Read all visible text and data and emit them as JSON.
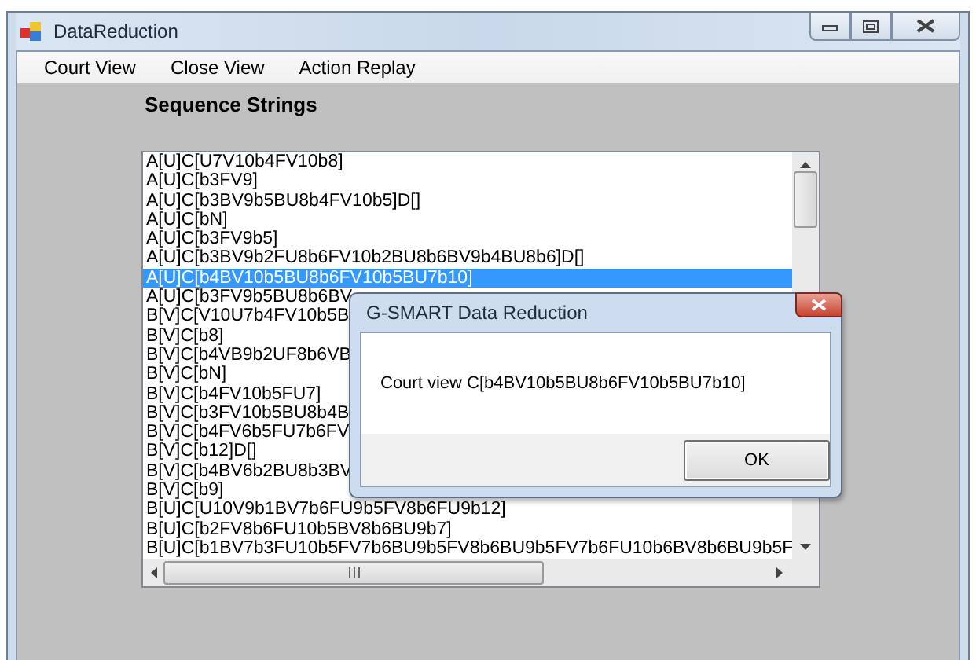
{
  "window": {
    "title": "DataReduction"
  },
  "menu": [
    {
      "label": "Court View"
    },
    {
      "label": "Close View"
    },
    {
      "label": "Action Replay"
    }
  ],
  "heading": "Sequence Strings",
  "list": {
    "items": [
      {
        "text": "A[U]C[U7V10b4FV10b8]",
        "selected": false
      },
      {
        "text": "A[U]C[b3FV9]",
        "selected": false
      },
      {
        "text": "A[U]C[b3BV9b5BU8b4FV10b5]D[]",
        "selected": false
      },
      {
        "text": "A[U]C[bN]",
        "selected": false
      },
      {
        "text": "A[U]C[b3FV9b5]",
        "selected": false
      },
      {
        "text": "A[U]C[b3BV9b2FU8b6FV10b2BU8b6BV9b4BU8b6]D[]",
        "selected": false
      },
      {
        "text": "A[U]C[b4BV10b5BU8b6FV10b5BU7b10]",
        "selected": true
      },
      {
        "text": "A[U]C[b3FV9b5BU8b6BV",
        "selected": false
      },
      {
        "text": "B[V]C[V10U7b4FV10b5B",
        "selected": false
      },
      {
        "text": "B[V]C[b8]",
        "selected": false
      },
      {
        "text": "B[V]C[b4VB9b2UF8b6VB",
        "selected": false
      },
      {
        "text": "B[V]C[bN]",
        "selected": false
      },
      {
        "text": "B[V]C[b4FV10b5FU7]",
        "selected": false
      },
      {
        "text": "B[V]C[b3FV10b5BU8b4B",
        "selected": false
      },
      {
        "text": "B[V]C[b4FV6b5FU7b6FV",
        "selected": false
      },
      {
        "text": "B[V]C[b12]D[]",
        "selected": false
      },
      {
        "text": "B[V]C[b4BV6b2BU8b3BV",
        "selected": false
      },
      {
        "text": "B[V]C[b9]",
        "selected": false
      },
      {
        "text": "B[U]C[U10V9b1BV7b6FU9b5FV8b6FU9b12]",
        "selected": false
      },
      {
        "text": "B[U]C[b2FV8b6FU10b5BV8b6BU9b7]",
        "selected": false
      },
      {
        "text": "B[U]C[b1BV7b3FU10b5FV7b6BU9b5FV8b6BU9b5FV7b6FU10b6BV8b6BU9b5F",
        "selected": false
      }
    ]
  },
  "dialog": {
    "title": "G-SMART Data Reduction",
    "message": "Court view C[b4BV10b5BU8b6FV10b5BU7b10]",
    "buttons": [
      "OK"
    ]
  }
}
